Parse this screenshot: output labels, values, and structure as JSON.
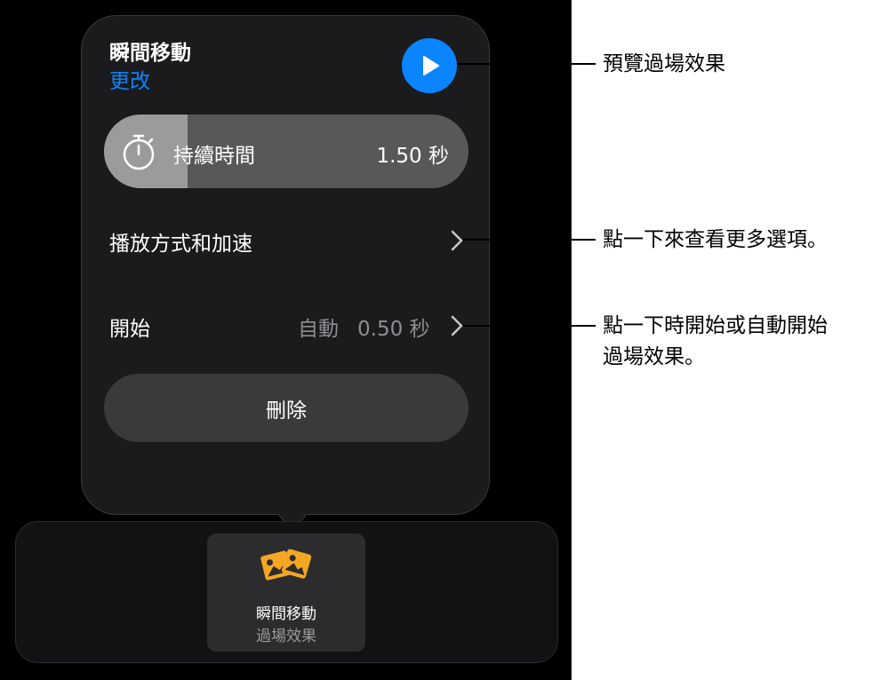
{
  "popover": {
    "title": "瞬間移動",
    "change_link": "更改",
    "duration": {
      "label": "持續時間",
      "value": "1.50 秒",
      "fill_fraction": 0.23
    },
    "playback_row": {
      "label": "播放方式和加速"
    },
    "start_row": {
      "label": "開始",
      "mode": "自動",
      "delay": "0.50 秒"
    },
    "delete_label": "刪除"
  },
  "tray": {
    "tile": {
      "name": "瞬間移動",
      "type": "過場效果",
      "icon": "images-icon",
      "icon_color": "#f5a623"
    }
  },
  "callouts": {
    "preview": "預覽過場效果",
    "more_options": "點一下來查看更多選項。",
    "start_line1": "點一下時開始或自動開始",
    "start_line2": "過場效果。"
  },
  "colors": {
    "accent": "#0a84ff",
    "background": "#000000"
  }
}
